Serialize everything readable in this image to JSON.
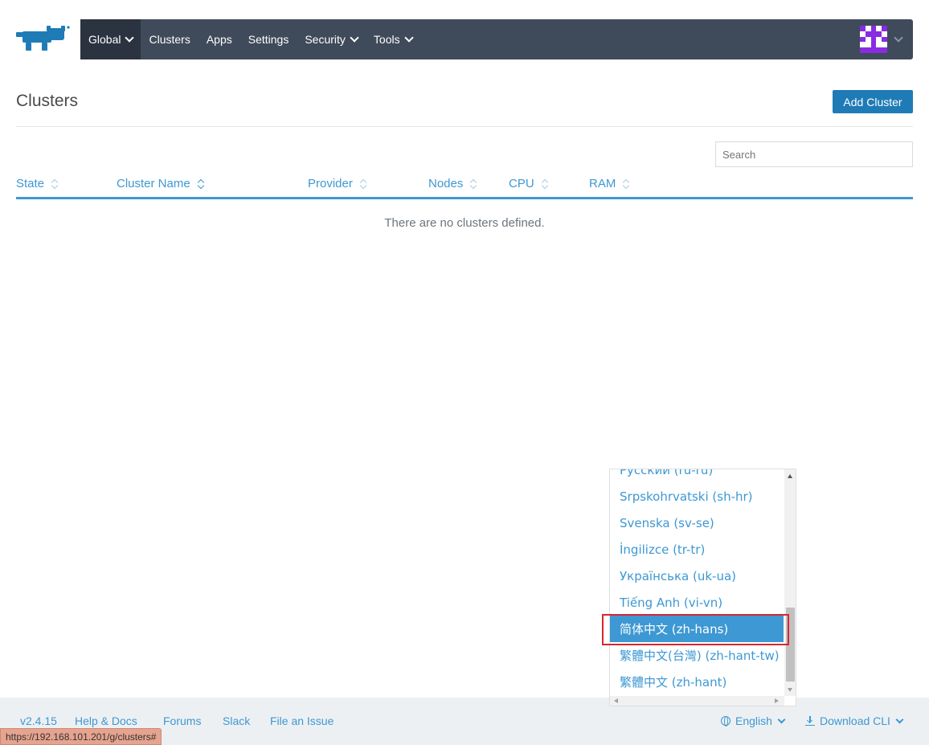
{
  "brand": {
    "logo_icon": "rancher-cow-logo-icon",
    "color": "#1f7bb6"
  },
  "nav": {
    "items": [
      {
        "label": "Global",
        "has_dropdown": true,
        "active": true
      },
      {
        "label": "Clusters",
        "has_dropdown": false
      },
      {
        "label": "Apps",
        "has_dropdown": false
      },
      {
        "label": "Settings",
        "has_dropdown": false
      },
      {
        "label": "Security",
        "has_dropdown": true
      },
      {
        "label": "Tools",
        "has_dropdown": true
      }
    ],
    "background": "#3f4a5a",
    "avatar_icon": "user-identicon"
  },
  "page": {
    "title": "Clusters",
    "add_button": "Add Cluster",
    "search_placeholder": "Search"
  },
  "table": {
    "columns": [
      "State",
      "Cluster Name",
      "Provider",
      "Nodes",
      "CPU",
      "RAM"
    ],
    "empty_message": "There are no clusters defined."
  },
  "language_menu": {
    "items": [
      "Русский (ru-ru)",
      "Srpskohrvatski (sh-hr)",
      "Svenska (sv-se)",
      "İngilizce (tr-tr)",
      "Українська (uk-ua)",
      "Tiếng Anh (vi-vn)",
      "简体中文 (zh-hans)",
      "繁體中文(台灣) (zh-hant-tw)",
      "繁體中文 (zh-hant)"
    ],
    "selected": "简体中文 (zh-hans)"
  },
  "footer": {
    "version": "v2.4.15",
    "help": "Help & Docs",
    "forums": "Forums",
    "slack": "Slack",
    "file_issue": "File an Issue",
    "language": "English",
    "download_cli": "Download CLI"
  },
  "status_bar": {
    "url": "https://192.168.101.201/g/clusters#"
  }
}
